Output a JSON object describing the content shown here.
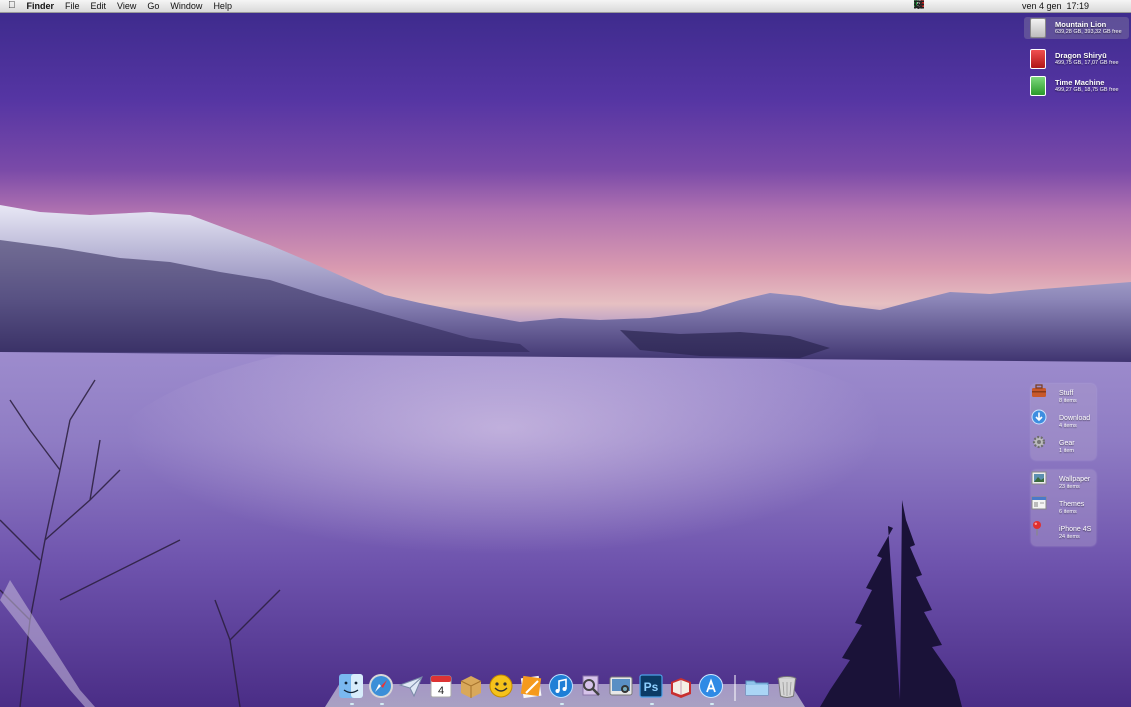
{
  "menubar": {
    "apple_icon": "apple-logo-icon",
    "app_name": "Finder",
    "menus": [
      "File",
      "Edit",
      "View",
      "Go",
      "Window",
      "Help"
    ],
    "status_icons": [
      "dropbox-icon",
      "evernote-icon",
      "checkmark-icon",
      "bluetooth-icon",
      "italian-flag-icon",
      "time-machine-icon"
    ],
    "clock": "ven 4 gen  17:19",
    "spotlight_icon": "spotlight-search-icon",
    "notification_icon": "notification-center-icon"
  },
  "drives": [
    {
      "name": "Mountain Lion",
      "info": "639,28 GB, 393,32 GB free",
      "icon": "internal-disk-icon",
      "color": "#d8d8d8",
      "selected": true
    },
    {
      "name": "Dragon Shiryū",
      "info": "499,75 GB, 17,07 GB free",
      "icon": "usb-drive-icon",
      "color": "#d12020",
      "selected": false
    },
    {
      "name": "Time Machine",
      "info": "499,27 GB, 18,75 GB free",
      "icon": "time-machine-disk-icon",
      "color": "#38a838",
      "selected": false
    }
  ],
  "stacks_top": [
    {
      "name": "Stuff",
      "count": "8 items",
      "icon": "toolbox-folder-icon"
    },
    {
      "name": "Download",
      "count": "4 items",
      "icon": "download-folder-icon"
    },
    {
      "name": "Gear",
      "count": "1 item",
      "icon": "gear-folder-icon"
    }
  ],
  "stacks_bottom": [
    {
      "name": "Wallpaper",
      "count": "23 items",
      "icon": "wallpaper-folder-icon"
    },
    {
      "name": "Themes",
      "count": "6 items",
      "icon": "themes-folder-icon"
    },
    {
      "name": "iPhone 4S",
      "count": "24 items",
      "icon": "map-pin-folder-icon"
    }
  ],
  "dock": {
    "apps": [
      "finder-icon",
      "safari-icon",
      "mail-icon",
      "calendar-icon",
      "archive-icon",
      "adium-icon",
      "pages-icon",
      "itunes-icon",
      "preview-icon",
      "screenshot-icon",
      "photoshop-icon",
      "ibooks-icon",
      "app-store-icon"
    ],
    "calendar_day": "4",
    "photoshop_label": "Ps",
    "folders": [
      "applications-folder-icon",
      "trash-icon"
    ]
  }
}
